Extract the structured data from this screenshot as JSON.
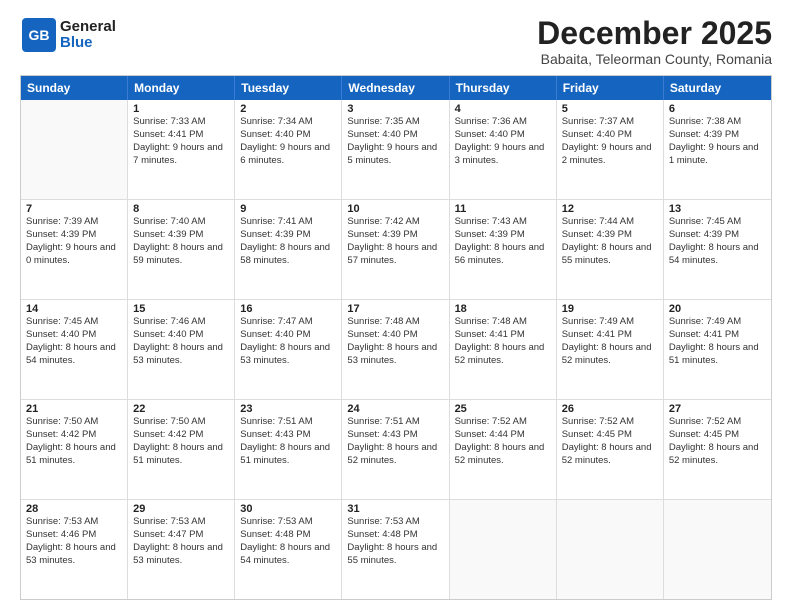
{
  "header": {
    "logo_line1": "General",
    "logo_line2": "Blue",
    "month": "December 2025",
    "location": "Babaita, Teleorman County, Romania"
  },
  "days_of_week": [
    "Sunday",
    "Monday",
    "Tuesday",
    "Wednesday",
    "Thursday",
    "Friday",
    "Saturday"
  ],
  "weeks": [
    [
      {
        "day": "",
        "sunrise": "",
        "sunset": "",
        "daylight": ""
      },
      {
        "day": "1",
        "sunrise": "Sunrise: 7:33 AM",
        "sunset": "Sunset: 4:41 PM",
        "daylight": "Daylight: 9 hours and 7 minutes."
      },
      {
        "day": "2",
        "sunrise": "Sunrise: 7:34 AM",
        "sunset": "Sunset: 4:40 PM",
        "daylight": "Daylight: 9 hours and 6 minutes."
      },
      {
        "day": "3",
        "sunrise": "Sunrise: 7:35 AM",
        "sunset": "Sunset: 4:40 PM",
        "daylight": "Daylight: 9 hours and 5 minutes."
      },
      {
        "day": "4",
        "sunrise": "Sunrise: 7:36 AM",
        "sunset": "Sunset: 4:40 PM",
        "daylight": "Daylight: 9 hours and 3 minutes."
      },
      {
        "day": "5",
        "sunrise": "Sunrise: 7:37 AM",
        "sunset": "Sunset: 4:40 PM",
        "daylight": "Daylight: 9 hours and 2 minutes."
      },
      {
        "day": "6",
        "sunrise": "Sunrise: 7:38 AM",
        "sunset": "Sunset: 4:39 PM",
        "daylight": "Daylight: 9 hours and 1 minute."
      }
    ],
    [
      {
        "day": "7",
        "sunrise": "Sunrise: 7:39 AM",
        "sunset": "Sunset: 4:39 PM",
        "daylight": "Daylight: 9 hours and 0 minutes."
      },
      {
        "day": "8",
        "sunrise": "Sunrise: 7:40 AM",
        "sunset": "Sunset: 4:39 PM",
        "daylight": "Daylight: 8 hours and 59 minutes."
      },
      {
        "day": "9",
        "sunrise": "Sunrise: 7:41 AM",
        "sunset": "Sunset: 4:39 PM",
        "daylight": "Daylight: 8 hours and 58 minutes."
      },
      {
        "day": "10",
        "sunrise": "Sunrise: 7:42 AM",
        "sunset": "Sunset: 4:39 PM",
        "daylight": "Daylight: 8 hours and 57 minutes."
      },
      {
        "day": "11",
        "sunrise": "Sunrise: 7:43 AM",
        "sunset": "Sunset: 4:39 PM",
        "daylight": "Daylight: 8 hours and 56 minutes."
      },
      {
        "day": "12",
        "sunrise": "Sunrise: 7:44 AM",
        "sunset": "Sunset: 4:39 PM",
        "daylight": "Daylight: 8 hours and 55 minutes."
      },
      {
        "day": "13",
        "sunrise": "Sunrise: 7:45 AM",
        "sunset": "Sunset: 4:39 PM",
        "daylight": "Daylight: 8 hours and 54 minutes."
      }
    ],
    [
      {
        "day": "14",
        "sunrise": "Sunrise: 7:45 AM",
        "sunset": "Sunset: 4:40 PM",
        "daylight": "Daylight: 8 hours and 54 minutes."
      },
      {
        "day": "15",
        "sunrise": "Sunrise: 7:46 AM",
        "sunset": "Sunset: 4:40 PM",
        "daylight": "Daylight: 8 hours and 53 minutes."
      },
      {
        "day": "16",
        "sunrise": "Sunrise: 7:47 AM",
        "sunset": "Sunset: 4:40 PM",
        "daylight": "Daylight: 8 hours and 53 minutes."
      },
      {
        "day": "17",
        "sunrise": "Sunrise: 7:48 AM",
        "sunset": "Sunset: 4:40 PM",
        "daylight": "Daylight: 8 hours and 53 minutes."
      },
      {
        "day": "18",
        "sunrise": "Sunrise: 7:48 AM",
        "sunset": "Sunset: 4:41 PM",
        "daylight": "Daylight: 8 hours and 52 minutes."
      },
      {
        "day": "19",
        "sunrise": "Sunrise: 7:49 AM",
        "sunset": "Sunset: 4:41 PM",
        "daylight": "Daylight: 8 hours and 52 minutes."
      },
      {
        "day": "20",
        "sunrise": "Sunrise: 7:49 AM",
        "sunset": "Sunset: 4:41 PM",
        "daylight": "Daylight: 8 hours and 51 minutes."
      }
    ],
    [
      {
        "day": "21",
        "sunrise": "Sunrise: 7:50 AM",
        "sunset": "Sunset: 4:42 PM",
        "daylight": "Daylight: 8 hours and 51 minutes."
      },
      {
        "day": "22",
        "sunrise": "Sunrise: 7:50 AM",
        "sunset": "Sunset: 4:42 PM",
        "daylight": "Daylight: 8 hours and 51 minutes."
      },
      {
        "day": "23",
        "sunrise": "Sunrise: 7:51 AM",
        "sunset": "Sunset: 4:43 PM",
        "daylight": "Daylight: 8 hours and 51 minutes."
      },
      {
        "day": "24",
        "sunrise": "Sunrise: 7:51 AM",
        "sunset": "Sunset: 4:43 PM",
        "daylight": "Daylight: 8 hours and 52 minutes."
      },
      {
        "day": "25",
        "sunrise": "Sunrise: 7:52 AM",
        "sunset": "Sunset: 4:44 PM",
        "daylight": "Daylight: 8 hours and 52 minutes."
      },
      {
        "day": "26",
        "sunrise": "Sunrise: 7:52 AM",
        "sunset": "Sunset: 4:45 PM",
        "daylight": "Daylight: 8 hours and 52 minutes."
      },
      {
        "day": "27",
        "sunrise": "Sunrise: 7:52 AM",
        "sunset": "Sunset: 4:45 PM",
        "daylight": "Daylight: 8 hours and 52 minutes."
      }
    ],
    [
      {
        "day": "28",
        "sunrise": "Sunrise: 7:53 AM",
        "sunset": "Sunset: 4:46 PM",
        "daylight": "Daylight: 8 hours and 53 minutes."
      },
      {
        "day": "29",
        "sunrise": "Sunrise: 7:53 AM",
        "sunset": "Sunset: 4:47 PM",
        "daylight": "Daylight: 8 hours and 53 minutes."
      },
      {
        "day": "30",
        "sunrise": "Sunrise: 7:53 AM",
        "sunset": "Sunset: 4:48 PM",
        "daylight": "Daylight: 8 hours and 54 minutes."
      },
      {
        "day": "31",
        "sunrise": "Sunrise: 7:53 AM",
        "sunset": "Sunset: 4:48 PM",
        "daylight": "Daylight: 8 hours and 55 minutes."
      },
      {
        "day": "",
        "sunrise": "",
        "sunset": "",
        "daylight": ""
      },
      {
        "day": "",
        "sunrise": "",
        "sunset": "",
        "daylight": ""
      },
      {
        "day": "",
        "sunrise": "",
        "sunset": "",
        "daylight": ""
      }
    ]
  ]
}
